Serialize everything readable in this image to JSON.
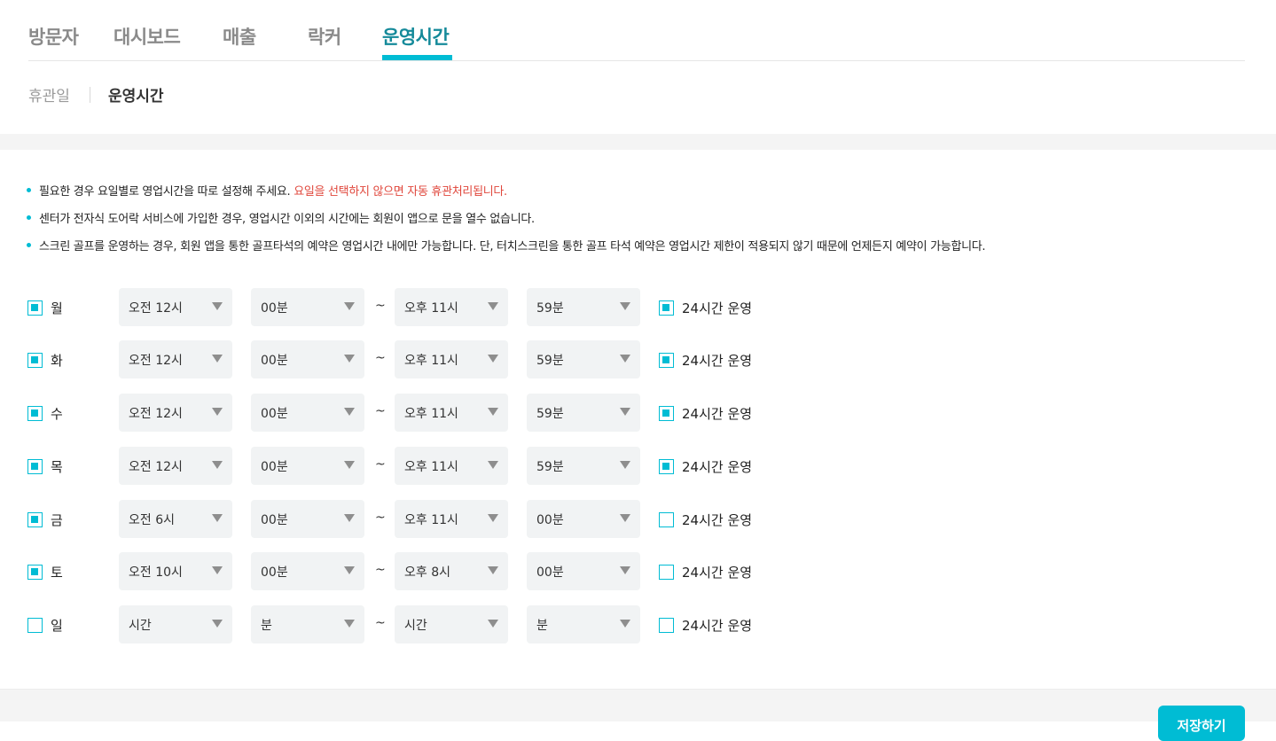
{
  "top_tabs": [
    {
      "label": "방문자",
      "active": false
    },
    {
      "label": "대시보드",
      "active": false
    },
    {
      "label": "매출",
      "active": false
    },
    {
      "label": "락커",
      "active": false
    },
    {
      "label": "운영시간",
      "active": true
    }
  ],
  "sub_tabs": [
    {
      "label": "휴관일",
      "active": false
    },
    {
      "label": "운영시간",
      "active": true
    }
  ],
  "notices": [
    {
      "text": "필요한 경우 요일별로 영업시간을 따로 설정해 주세요. ",
      "warning": "요일을 선택하지 않으면 자동 휴관처리됩니다."
    },
    {
      "text": "센터가 전자식 도어락 서비스에 가입한 경우, 영업시간 이외의 시간에는 회원이 앱으로 문을 열수 없습니다.",
      "warning": ""
    },
    {
      "text": "스크린 골프를 운영하는 경우, 회원 앱을 통한 골프타석의 예약은 영업시간 내에만 가능합니다. 단, 터치스크린을 통한 골프 타석 예약은 영업시간 제한이 적용되지 않기 때문에 언제든지 예약이 가능합니다.",
      "warning": ""
    }
  ],
  "schedule": [
    {
      "day": "월",
      "enabled": true,
      "start_hour": "오전 12시",
      "start_min": "00분",
      "end_hour": "오후 11시",
      "end_min": "59분",
      "h24": true
    },
    {
      "day": "화",
      "enabled": true,
      "start_hour": "오전 12시",
      "start_min": "00분",
      "end_hour": "오후 11시",
      "end_min": "59분",
      "h24": true
    },
    {
      "day": "수",
      "enabled": true,
      "start_hour": "오전 12시",
      "start_min": "00분",
      "end_hour": "오후 11시",
      "end_min": "59분",
      "h24": true
    },
    {
      "day": "목",
      "enabled": true,
      "start_hour": "오전 12시",
      "start_min": "00분",
      "end_hour": "오후 11시",
      "end_min": "59분",
      "h24": true
    },
    {
      "day": "금",
      "enabled": true,
      "start_hour": "오전 6시",
      "start_min": "00분",
      "end_hour": "오후 11시",
      "end_min": "00분",
      "h24": false
    },
    {
      "day": "토",
      "enabled": true,
      "start_hour": "오전 10시",
      "start_min": "00분",
      "end_hour": "오후 8시",
      "end_min": "00분",
      "h24": false
    },
    {
      "day": "일",
      "enabled": false,
      "start_hour": "시간",
      "start_min": "분",
      "end_hour": "시간",
      "end_min": "분",
      "h24": false
    }
  ],
  "tilde": "~",
  "h24_label": "24시간 운영",
  "save_label": "저장하기",
  "colors": {
    "accent": "#00bcd4",
    "active_tab": "#158a9a",
    "warning": "#e0473c"
  }
}
